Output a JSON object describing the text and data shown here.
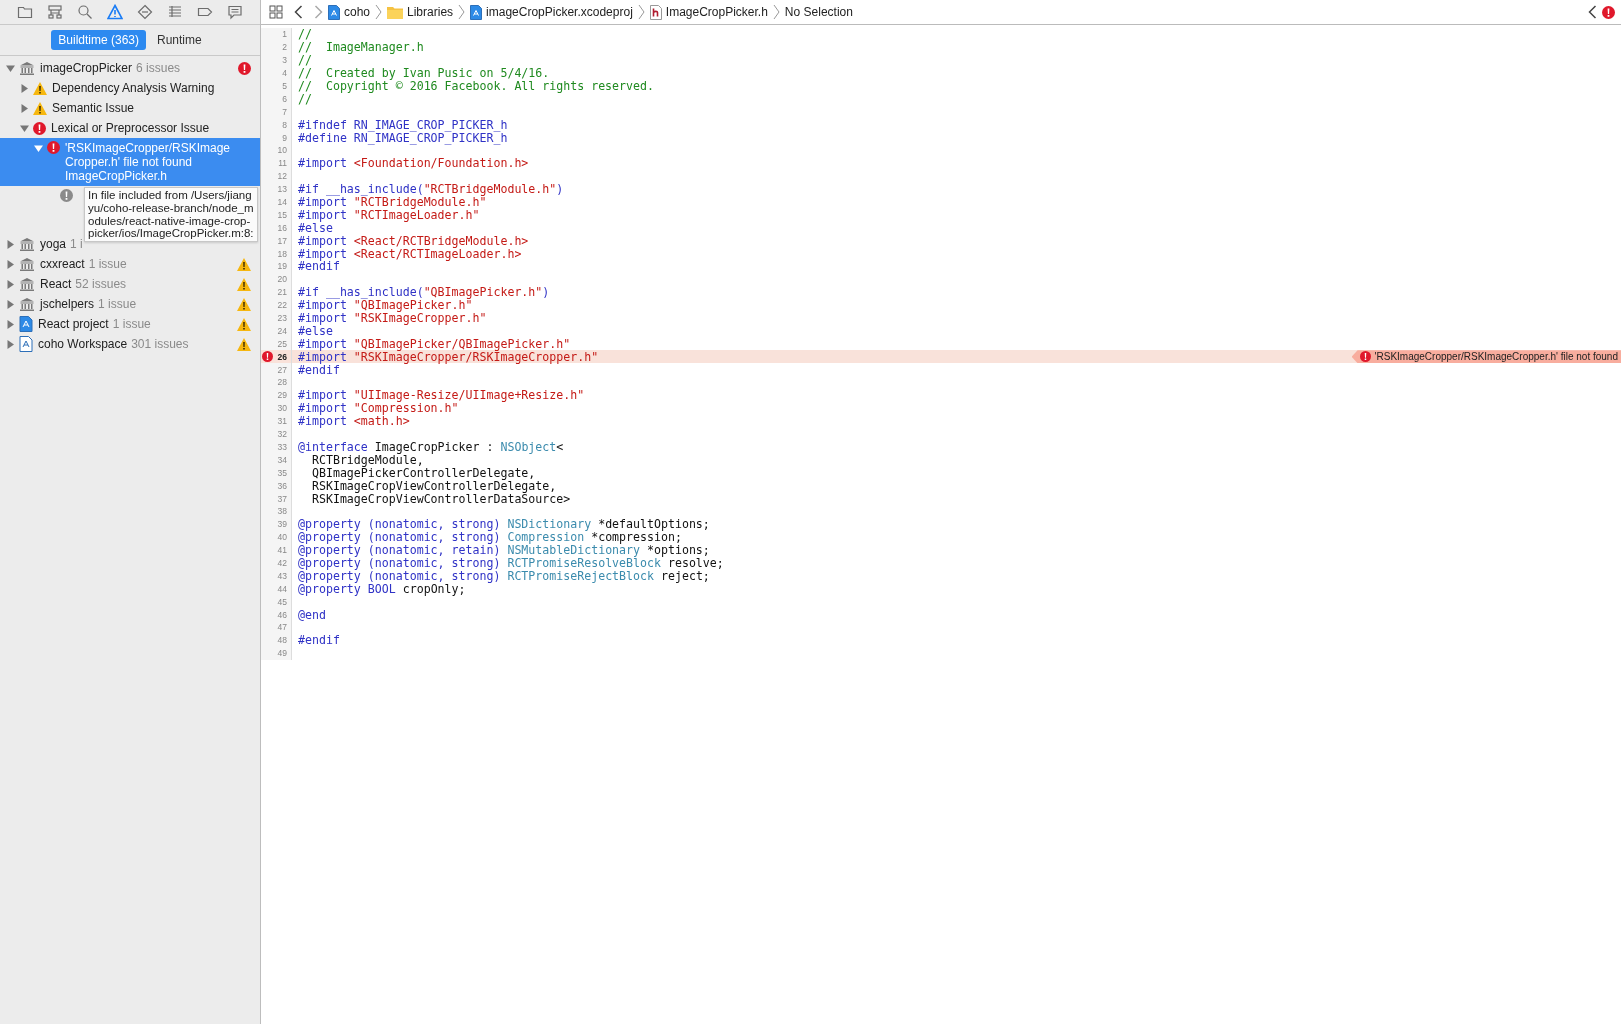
{
  "navigator": {
    "toolbar": [
      {
        "selected": false
      },
      {
        "selected": false
      },
      {
        "selected": false
      },
      {
        "selected": true
      },
      {
        "selected": false
      },
      {
        "selected": false
      },
      {
        "selected": false
      },
      {
        "selected": false
      }
    ],
    "tabs": [
      {
        "label": "Buildtime (363)",
        "selected": true
      },
      {
        "label": "Runtime",
        "selected": false
      }
    ],
    "tree": [
      {
        "kind": "library",
        "name": "imageCropPicker",
        "count": "6 issues",
        "error": true,
        "warning": false,
        "expanded": true,
        "selected": false,
        "children": [
          {
            "kind": "warning",
            "name": "Dependency Analysis Warning",
            "expanded": false,
            "selected": false
          },
          {
            "kind": "warning",
            "name": "Semantic Issue",
            "expanded": false,
            "selected": false
          },
          {
            "kind": "error",
            "name": "Lexical or Preprocessor Issue",
            "expanded": true,
            "selected": false,
            "children": [
              {
                "kind": "error",
                "name": "'RSKImageCropper/RSKImageCropper.h' file not found",
                "subtitle": "ImageCropPicker.h",
                "expanded": true,
                "selected": true,
                "children": [
                  {
                    "kind": "note",
                    "name": "In file included from /Users/jiangyu/coho-release-branch/node_modules/react-native-image-crop-picker/ios/ImageCropPicker.m:8:"
                  }
                ]
              }
            ]
          }
        ]
      },
      {
        "kind": "library",
        "name": "yoga",
        "count": "1 i",
        "error": false,
        "warning": false,
        "expanded": false,
        "selected": false
      },
      {
        "kind": "library",
        "name": "cxxreact",
        "count": "1 issue",
        "error": false,
        "warning": true,
        "expanded": false,
        "selected": false
      },
      {
        "kind": "library",
        "name": "React",
        "count": "52 issues",
        "error": false,
        "warning": true,
        "expanded": false,
        "selected": false
      },
      {
        "kind": "library",
        "name": "jschelpers",
        "count": "1 issue",
        "error": false,
        "warning": true,
        "expanded": false,
        "selected": false
      },
      {
        "kind": "project",
        "name": "React project",
        "count": "1 issue",
        "error": false,
        "warning": true,
        "expanded": false,
        "selected": false
      },
      {
        "kind": "workspace",
        "name": "coho Workspace",
        "count": "301 issues",
        "error": false,
        "warning": true,
        "expanded": false,
        "selected": false
      }
    ]
  },
  "editor": {
    "breadcrumbs": [
      {
        "kind": "project",
        "label": "coho"
      },
      {
        "kind": "folder",
        "label": "Libraries"
      },
      {
        "kind": "project",
        "label": "imageCropPicker.xcodeproj"
      },
      {
        "kind": "header",
        "label": "ImageCropPicker.h"
      },
      {
        "kind": "plain",
        "label": "No Selection"
      }
    ],
    "has_error": true,
    "lines": [
      {
        "number": "1",
        "tokens": [
          {
            "kind": "comment",
            "text": "//"
          }
        ]
      },
      {
        "number": "2",
        "tokens": [
          {
            "kind": "comment",
            "text": "//  ImageManager.h"
          }
        ]
      },
      {
        "number": "3",
        "tokens": [
          {
            "kind": "comment",
            "text": "//"
          }
        ]
      },
      {
        "number": "4",
        "tokens": [
          {
            "kind": "comment",
            "text": "//  Created by Ivan Pusic on 5/4/16."
          }
        ]
      },
      {
        "number": "5",
        "tokens": [
          {
            "kind": "comment",
            "text": "//  Copyright © 2016 Facebook. All rights reserved."
          }
        ]
      },
      {
        "number": "6",
        "tokens": [
          {
            "kind": "comment",
            "text": "//"
          }
        ]
      },
      {
        "number": "7"
      },
      {
        "number": "8",
        "tokens": [
          {
            "kind": "keyword",
            "text": "#ifndef RN_IMAGE_CROP_PICKER_h"
          }
        ]
      },
      {
        "number": "9",
        "tokens": [
          {
            "kind": "keyword",
            "text": "#define RN_IMAGE_CROP_PICKER_h"
          }
        ]
      },
      {
        "number": "10"
      },
      {
        "number": "11",
        "tokens": [
          {
            "kind": "keyword",
            "text": "#import "
          },
          {
            "kind": "string",
            "text": "<Foundation/Foundation.h>"
          }
        ]
      },
      {
        "number": "12"
      },
      {
        "number": "13",
        "tokens": [
          {
            "kind": "keyword",
            "text": "#if __has_include("
          },
          {
            "kind": "string",
            "text": "\"RCTBridgeModule.h\""
          },
          {
            "kind": "keyword",
            "text": ")"
          }
        ]
      },
      {
        "number": "14",
        "tokens": [
          {
            "kind": "keyword",
            "text": "#import "
          },
          {
            "kind": "string",
            "text": "\"RCTBridgeModule.h\""
          }
        ]
      },
      {
        "number": "15",
        "tokens": [
          {
            "kind": "keyword",
            "text": "#import "
          },
          {
            "kind": "string",
            "text": "\"RCTImageLoader.h\""
          }
        ]
      },
      {
        "number": "16",
        "tokens": [
          {
            "kind": "keyword",
            "text": "#else"
          }
        ]
      },
      {
        "number": "17",
        "tokens": [
          {
            "kind": "keyword",
            "text": "#import "
          },
          {
            "kind": "string",
            "text": "<React/RCTBridgeModule.h>"
          }
        ]
      },
      {
        "number": "18",
        "tokens": [
          {
            "kind": "keyword",
            "text": "#import "
          },
          {
            "kind": "string",
            "text": "<React/RCTImageLoader.h>"
          }
        ]
      },
      {
        "number": "19",
        "tokens": [
          {
            "kind": "keyword",
            "text": "#endif"
          }
        ]
      },
      {
        "number": "20"
      },
      {
        "number": "21",
        "tokens": [
          {
            "kind": "keyword",
            "text": "#if __has_include("
          },
          {
            "kind": "string",
            "text": "\"QBImagePicker.h\""
          },
          {
            "kind": "keyword",
            "text": ")"
          }
        ]
      },
      {
        "number": "22",
        "tokens": [
          {
            "kind": "keyword",
            "text": "#import "
          },
          {
            "kind": "string",
            "text": "\"QBImagePicker.h\""
          }
        ]
      },
      {
        "number": "23",
        "tokens": [
          {
            "kind": "keyword",
            "text": "#import "
          },
          {
            "kind": "string",
            "text": "\"RSKImageCropper.h\""
          }
        ]
      },
      {
        "number": "24",
        "tokens": [
          {
            "kind": "keyword",
            "text": "#else"
          }
        ]
      },
      {
        "number": "25",
        "tokens": [
          {
            "kind": "keyword",
            "text": "#import "
          },
          {
            "kind": "string",
            "text": "\"QBImagePicker/QBImagePicker.h\""
          }
        ]
      },
      {
        "number": "26",
        "tokens": [
          {
            "kind": "keyword",
            "text": "#import "
          },
          {
            "kind": "string",
            "text": "\"RSKImageCropper/RSKImageCropper.h\""
          }
        ],
        "error": true,
        "error_message": "'RSKImageCropper/RSKImageCropper.h' file not found"
      },
      {
        "number": "27",
        "tokens": [
          {
            "kind": "keyword",
            "text": "#endif"
          }
        ]
      },
      {
        "number": "28"
      },
      {
        "number": "29",
        "tokens": [
          {
            "kind": "keyword",
            "text": "#import "
          },
          {
            "kind": "string",
            "text": "\"UIImage-Resize/UIImage+Resize.h\""
          }
        ]
      },
      {
        "number": "30",
        "tokens": [
          {
            "kind": "keyword",
            "text": "#import "
          },
          {
            "kind": "string",
            "text": "\"Compression.h\""
          }
        ]
      },
      {
        "number": "31",
        "tokens": [
          {
            "kind": "keyword",
            "text": "#import "
          },
          {
            "kind": "string",
            "text": "<math.h>"
          }
        ]
      },
      {
        "number": "32"
      },
      {
        "number": "33",
        "tokens": [
          {
            "kind": "keyword",
            "text": "@interface"
          },
          {
            "kind": "plain",
            "text": " ImageCropPicker : "
          },
          {
            "kind": "type",
            "text": "NSObject"
          },
          {
            "kind": "plain",
            "text": "<"
          }
        ]
      },
      {
        "number": "34",
        "tokens": [
          {
            "kind": "plain",
            "text": "  RCTBridgeModule,"
          }
        ]
      },
      {
        "number": "35",
        "tokens": [
          {
            "kind": "plain",
            "text": "  QBImagePickerControllerDelegate,"
          }
        ]
      },
      {
        "number": "36",
        "tokens": [
          {
            "kind": "plain",
            "text": "  RSKImageCropViewControllerDelegate,"
          }
        ]
      },
      {
        "number": "37",
        "tokens": [
          {
            "kind": "plain",
            "text": "  RSKImageCropViewControllerDataSource>"
          }
        ]
      },
      {
        "number": "38"
      },
      {
        "number": "39",
        "tokens": [
          {
            "kind": "keyword",
            "text": "@property (nonatomic, strong) "
          },
          {
            "kind": "type",
            "text": "NSDictionary"
          },
          {
            "kind": "plain",
            "text": " *defaultOptions;"
          }
        ]
      },
      {
        "number": "40",
        "tokens": [
          {
            "kind": "keyword",
            "text": "@property (nonatomic, strong) "
          },
          {
            "kind": "type",
            "text": "Compression"
          },
          {
            "kind": "plain",
            "text": " *compression;"
          }
        ]
      },
      {
        "number": "41",
        "tokens": [
          {
            "kind": "keyword",
            "text": "@property (nonatomic, retain) "
          },
          {
            "kind": "type",
            "text": "NSMutableDictionary"
          },
          {
            "kind": "plain",
            "text": " *options;"
          }
        ]
      },
      {
        "number": "42",
        "tokens": [
          {
            "kind": "keyword",
            "text": "@property (nonatomic, strong) "
          },
          {
            "kind": "type",
            "text": "RCTPromiseResolveBlock"
          },
          {
            "kind": "plain",
            "text": " resolve;"
          }
        ]
      },
      {
        "number": "43",
        "tokens": [
          {
            "kind": "keyword",
            "text": "@property (nonatomic, strong) "
          },
          {
            "kind": "type",
            "text": "RCTPromiseRejectBlock"
          },
          {
            "kind": "plain",
            "text": " reject;"
          }
        ]
      },
      {
        "number": "44",
        "tokens": [
          {
            "kind": "keyword",
            "text": "@property BOOL"
          },
          {
            "kind": "plain",
            "text": " cropOnly;"
          }
        ]
      },
      {
        "number": "45"
      },
      {
        "number": "46",
        "tokens": [
          {
            "kind": "keyword",
            "text": "@end"
          }
        ]
      },
      {
        "number": "47"
      },
      {
        "number": "48",
        "tokens": [
          {
            "kind": "keyword",
            "text": "#endif"
          }
        ]
      },
      {
        "number": "49"
      }
    ]
  }
}
